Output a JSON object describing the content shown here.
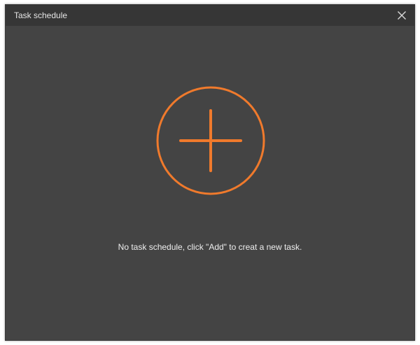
{
  "window": {
    "title": "Task schedule"
  },
  "empty_state": {
    "message": "No task schedule, click \"Add\" to creat a new task."
  },
  "icons": {
    "close": "close-icon",
    "add": "plus-circle-icon"
  },
  "colors": {
    "accent": "#f07a2c",
    "background": "#444444",
    "titlebar": "#363636",
    "text": "#eeeeee"
  }
}
